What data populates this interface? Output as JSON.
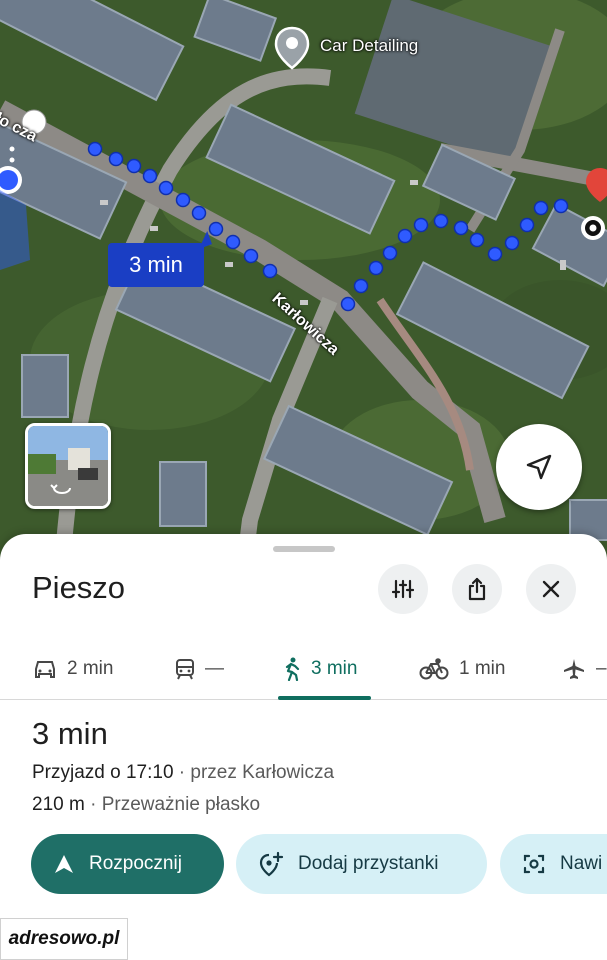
{
  "map": {
    "poi_label": "Car Detailing",
    "street_label": "Karłowicza",
    "street_label_partial": "ło   cza",
    "eta_bubble": "3 min"
  },
  "sheet": {
    "title": "Pieszo",
    "buttons": {
      "options_icon": "tune-icon",
      "share_icon": "share-icon",
      "close_icon": "close-icon"
    },
    "modes": [
      {
        "icon": "car-icon",
        "label": "2 min",
        "active": false
      },
      {
        "icon": "train-icon",
        "label": "—",
        "active": false
      },
      {
        "icon": "walk-icon",
        "label": "3 min",
        "active": true
      },
      {
        "icon": "bike-icon",
        "label": "1 min",
        "active": false
      },
      {
        "icon": "plane-icon",
        "label": "–",
        "active": false
      }
    ],
    "route": {
      "duration": "3 min",
      "arrival": "Przyjazd o 17:10",
      "via": " · przez Karłowicza",
      "distance": "210 m",
      "terrain": " · Przeważnie płasko"
    },
    "actions": {
      "start": "Rozpocznij",
      "add_stops": "Dodaj przystanki",
      "navigate_partial": "Nawi"
    }
  },
  "watermark": "adresowo.pl",
  "colors": {
    "accent": "#1f6f67",
    "route_dot": "#2f5bff",
    "eta_bubble": "#1a3ec4",
    "secondary_button": "#d6f0f6"
  }
}
